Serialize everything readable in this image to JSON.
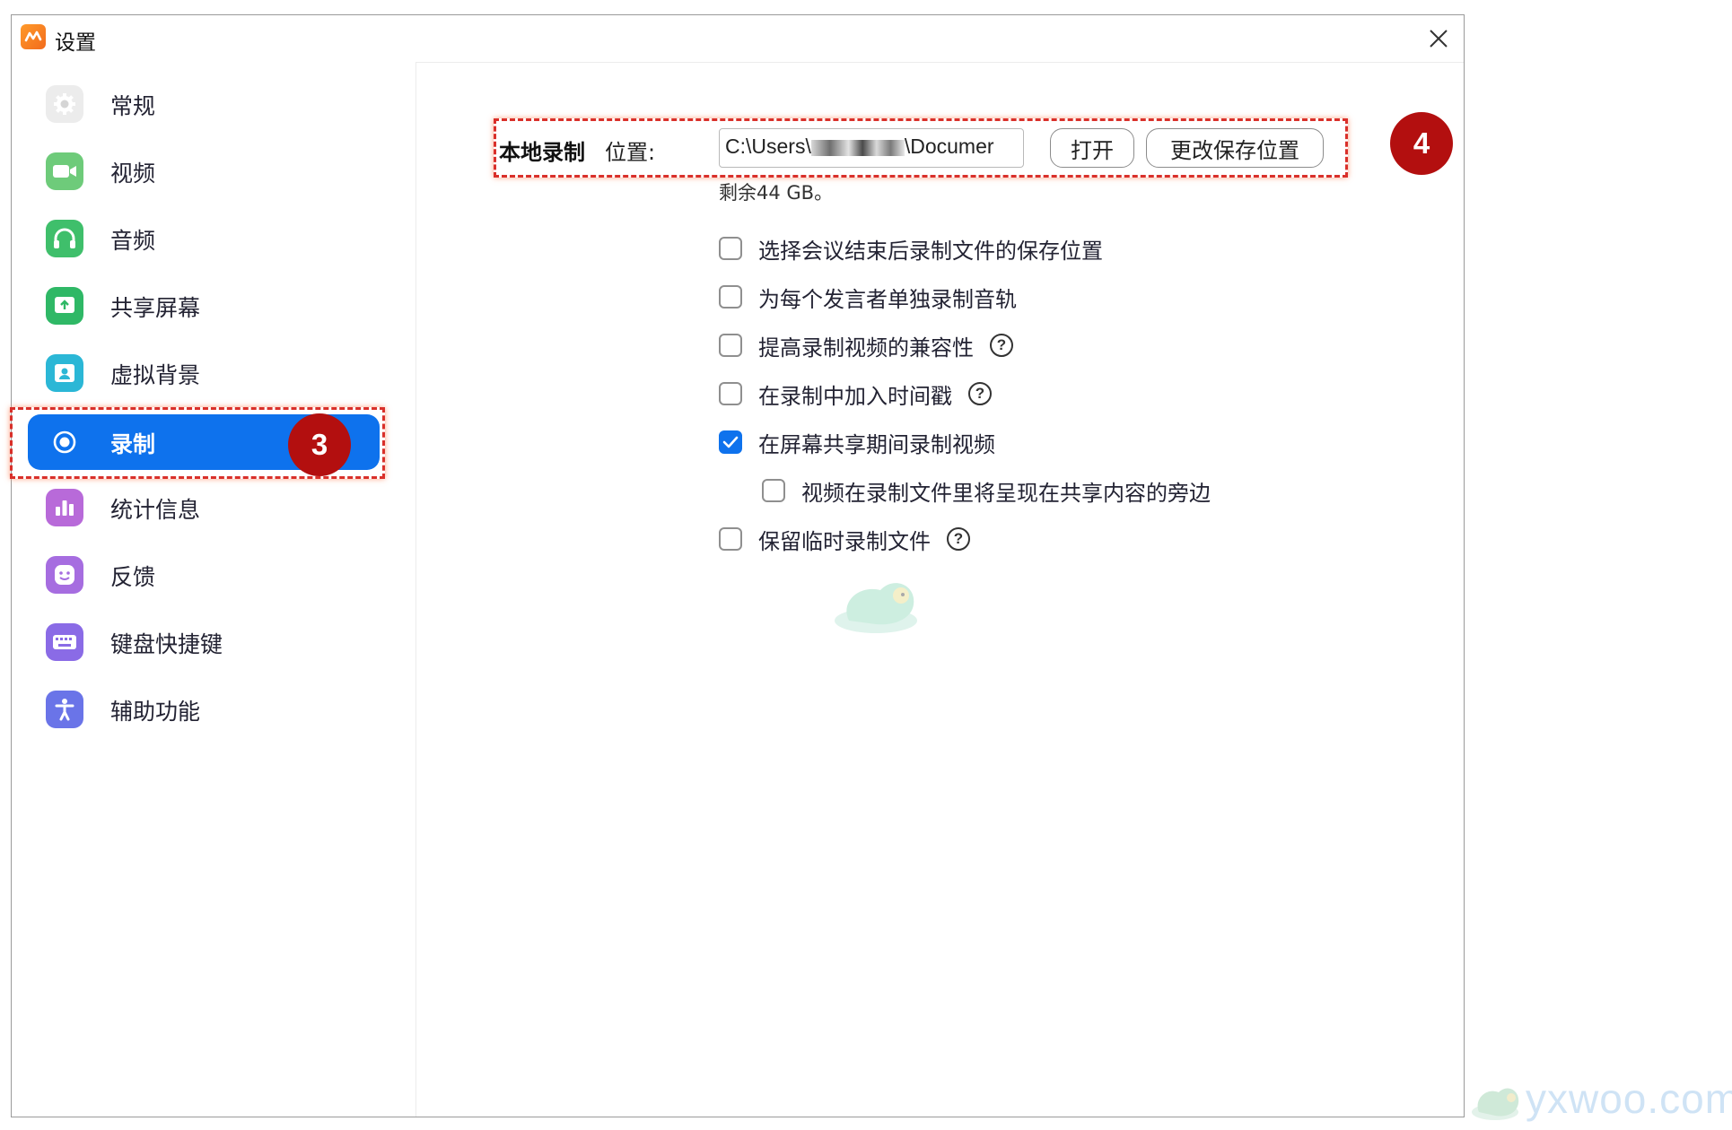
{
  "window": {
    "title": "设置"
  },
  "sidebar": {
    "items": [
      {
        "label": "常规",
        "icon": "gear-icon",
        "color": "#e6e6e6"
      },
      {
        "label": "视频",
        "icon": "video-camera-icon",
        "color": "#6ecb7a"
      },
      {
        "label": "音频",
        "icon": "headphones-icon",
        "color": "#3fbf6b"
      },
      {
        "label": "共享屏幕",
        "icon": "share-screen-icon",
        "color": "#2fb866"
      },
      {
        "label": "虚拟背景",
        "icon": "virtual-background-icon",
        "color": "#2bb7d6"
      },
      {
        "label": "录制",
        "icon": "record-icon",
        "color": "#0e72ed",
        "active": true
      },
      {
        "label": "统计信息",
        "icon": "statistics-icon",
        "color": "#b86ad9"
      },
      {
        "label": "反馈",
        "icon": "feedback-smile-icon",
        "color": "#a66de0"
      },
      {
        "label": "键盘快捷键",
        "icon": "keyboard-icon",
        "color": "#8a6be6"
      },
      {
        "label": "辅助功能",
        "icon": "accessibility-icon",
        "color": "#6a74e8"
      }
    ]
  },
  "recording": {
    "section_title": "本地录制",
    "location_label": "位置:",
    "path_value": "C:\\Users\\",
    "path_suffix": "\\Documer",
    "open_button": "打开",
    "change_button": "更改保存位置",
    "free_space": "剩余44 GB。",
    "options": [
      {
        "label": "选择会议结束后录制文件的保存位置",
        "checked": false,
        "help": false
      },
      {
        "label": "为每个发言者单独录制音轨",
        "checked": false,
        "help": false
      },
      {
        "label": "提高录制视频的兼容性",
        "checked": false,
        "help": true
      },
      {
        "label": "在录制中加入时间戳",
        "checked": false,
        "help": true
      },
      {
        "label": "在屏幕共享期间录制视频",
        "checked": true,
        "help": false
      },
      {
        "label": "视频在录制文件里将呈现在共享内容的旁边",
        "checked": false,
        "help": false,
        "indent": true
      },
      {
        "label": "保留临时录制文件",
        "checked": false,
        "help": true
      }
    ],
    "help_glyph": "?"
  },
  "annotations": {
    "step3": "3",
    "step4": "4"
  },
  "watermark": "yxwoo.com",
  "colors": {
    "accent": "#0e72ed",
    "annotation": "#d9302a",
    "badge": "#b30f0f"
  }
}
